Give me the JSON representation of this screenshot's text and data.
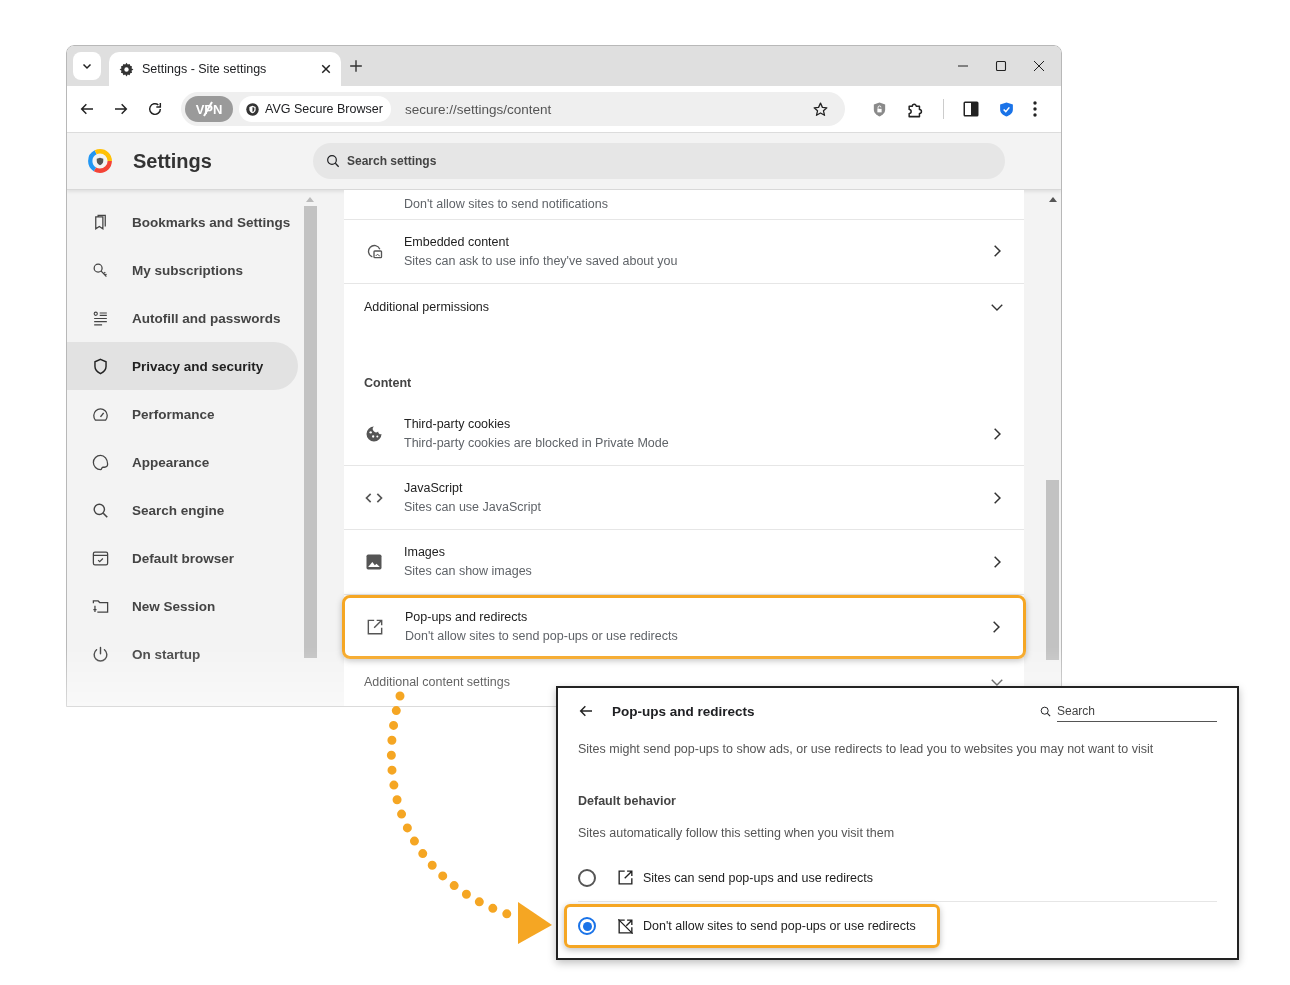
{
  "browser": {
    "tab_title": "Settings - Site settings",
    "vpn_label": "VPN",
    "site_badge": "AVG Secure Browser",
    "url": "secure://settings/content"
  },
  "settings": {
    "title": "Settings",
    "search_placeholder": "Search settings"
  },
  "sidebar": [
    {
      "label": "Bookmarks and Settings",
      "selected": false
    },
    {
      "label": "My subscriptions",
      "selected": false
    },
    {
      "label": "Autofill and passwords",
      "selected": false
    },
    {
      "label": "Privacy and security",
      "selected": true
    },
    {
      "label": "Performance",
      "selected": false
    },
    {
      "label": "Appearance",
      "selected": false
    },
    {
      "label": "Search engine",
      "selected": false
    },
    {
      "label": "Default browser",
      "selected": false
    },
    {
      "label": "New Session",
      "selected": false
    },
    {
      "label": "On startup",
      "selected": false
    }
  ],
  "content": [
    {
      "kind": "partial",
      "subtitle": "Don't allow sites to send notifications"
    },
    {
      "kind": "row",
      "title": "Embedded content",
      "subtitle": "Sites can ask to use info they've saved about you",
      "highlighted": false
    },
    {
      "kind": "expander",
      "label": "Additional permissions"
    },
    {
      "kind": "heading",
      "label": "Content"
    },
    {
      "kind": "row",
      "title": "Third-party cookies",
      "subtitle": "Third-party cookies are blocked in Private Mode",
      "highlighted": false
    },
    {
      "kind": "row",
      "title": "JavaScript",
      "subtitle": "Sites can use JavaScript",
      "highlighted": false
    },
    {
      "kind": "row",
      "title": "Images",
      "subtitle": "Sites can show images",
      "highlighted": false
    },
    {
      "kind": "row",
      "title": "Pop-ups and redirects",
      "subtitle": "Don't allow sites to send pop-ups or use redirects",
      "highlighted": true
    },
    {
      "kind": "expander",
      "label": "Additional content settings"
    }
  ],
  "popup_panel": {
    "title": "Pop-ups and redirects",
    "search_placeholder": "Search",
    "description": "Sites might send pop-ups to show ads, or use redirects to lead you to websites you may not want to visit",
    "section": "Default behavior",
    "section_note": "Sites automatically follow this setting when you visit them",
    "options": [
      {
        "label": "Sites can send pop-ups and use redirects",
        "selected": false,
        "highlighted": false
      },
      {
        "label": "Don't allow sites to send pop-ups or use redirects",
        "selected": true,
        "highlighted": true
      }
    ]
  }
}
